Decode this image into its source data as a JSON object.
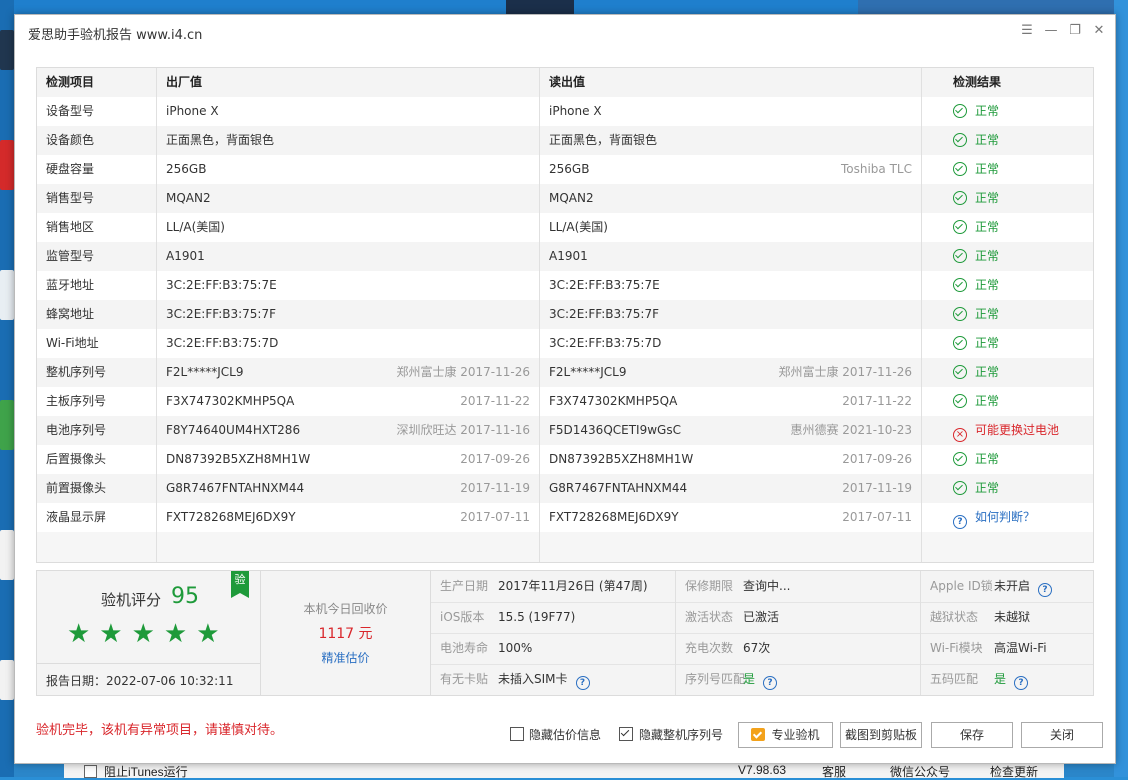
{
  "window": {
    "title": "爱思助手验机报告 www.i4.cn"
  },
  "table": {
    "headers": [
      "检测项目",
      "出厂值",
      "读出值",
      "检测结果"
    ],
    "rows": [
      {
        "item": "设备型号",
        "factory": "iPhone X",
        "factory_note": "",
        "read": "iPhone X",
        "read_note": "",
        "result": "正常",
        "status": "ok"
      },
      {
        "item": "设备颜色",
        "factory": "正面黑色，背面银色",
        "factory_note": "",
        "read": "正面黑色，背面银色",
        "read_note": "",
        "result": "正常",
        "status": "ok"
      },
      {
        "item": "硬盘容量",
        "factory": "256GB",
        "factory_note": "",
        "read": "256GB",
        "read_note": "Toshiba TLC",
        "result": "正常",
        "status": "ok"
      },
      {
        "item": "销售型号",
        "factory": "MQAN2",
        "factory_note": "",
        "read": "MQAN2",
        "read_note": "",
        "result": "正常",
        "status": "ok"
      },
      {
        "item": "销售地区",
        "factory": "LL/A(美国)",
        "factory_note": "",
        "read": "LL/A(美国)",
        "read_note": "",
        "result": "正常",
        "status": "ok"
      },
      {
        "item": "监管型号",
        "factory": "A1901",
        "factory_note": "",
        "read": "A1901",
        "read_note": "",
        "result": "正常",
        "status": "ok"
      },
      {
        "item": "蓝牙地址",
        "factory": "3C:2E:FF:B3:75:7E",
        "factory_note": "",
        "read": "3C:2E:FF:B3:75:7E",
        "read_note": "",
        "result": "正常",
        "status": "ok"
      },
      {
        "item": "蜂窝地址",
        "factory": "3C:2E:FF:B3:75:7F",
        "factory_note": "",
        "read": "3C:2E:FF:B3:75:7F",
        "read_note": "",
        "result": "正常",
        "status": "ok"
      },
      {
        "item": "Wi-Fi地址",
        "factory": "3C:2E:FF:B3:75:7D",
        "factory_note": "",
        "read": "3C:2E:FF:B3:75:7D",
        "read_note": "",
        "result": "正常",
        "status": "ok"
      },
      {
        "item": "整机序列号",
        "factory": "F2L*****JCL9",
        "factory_note": "郑州富士康 2017-11-26",
        "read": "F2L*****JCL9",
        "read_note": "郑州富士康 2017-11-26",
        "result": "正常",
        "status": "ok"
      },
      {
        "item": "主板序列号",
        "factory": "F3X747302KMHP5QA",
        "factory_note": "2017-11-22",
        "read": "F3X747302KMHP5QA",
        "read_note": "2017-11-22",
        "result": "正常",
        "status": "ok"
      },
      {
        "item": "电池序列号",
        "factory": "F8Y74640UM4HXT286",
        "factory_note": "深圳欣旺达 2017-11-16",
        "read": "F5D1436QCETI9wGsC",
        "read_note": "惠州德赛 2021-10-23",
        "result": "可能更换过电池",
        "status": "err"
      },
      {
        "item": "后置摄像头",
        "factory": "DN87392B5XZH8MH1W",
        "factory_note": "2017-09-26",
        "read": "DN87392B5XZH8MH1W",
        "read_note": "2017-09-26",
        "result": "正常",
        "status": "ok"
      },
      {
        "item": "前置摄像头",
        "factory": "G8R7467FNTAHNXM44",
        "factory_note": "2017-11-19",
        "read": "G8R7467FNTAHNXM44",
        "read_note": "2017-11-19",
        "result": "正常",
        "status": "ok"
      },
      {
        "item": "液晶显示屏",
        "factory": "FXT728268MEJ6DX9Y",
        "factory_note": "2017-07-11",
        "read": "FXT728268MEJ6DX9Y",
        "read_note": "2017-07-11",
        "result": "如何判断？",
        "status": "q"
      }
    ]
  },
  "score": {
    "label": "验机评分",
    "value": "95",
    "badge": "验",
    "stars": 5,
    "stars_text": "★★★★★",
    "report_date": "报告日期：2022-07-06 10:32:11"
  },
  "recycle": {
    "label": "本机今日回收价",
    "price": "1117",
    "unit": "元",
    "link": "精准估价"
  },
  "info": {
    "rows": [
      [
        {
          "k": "生产日期",
          "v": "2017年11月26日 (第47周)"
        },
        {
          "k": "保修期限",
          "v": "查询中..."
        },
        {
          "k": "Apple ID锁",
          "v": "未开启",
          "help": true
        }
      ],
      [
        {
          "k": "iOS版本",
          "v": "15.5 (19F77)"
        },
        {
          "k": "激活状态",
          "v": "已激活"
        },
        {
          "k": "越狱状态",
          "v": "未越狱"
        }
      ],
      [
        {
          "k": "电池寿命",
          "v": "100%"
        },
        {
          "k": "充电次数",
          "v": "67次"
        },
        {
          "k": "Wi-Fi模块",
          "v": "高温Wi-Fi"
        }
      ],
      [
        {
          "k": "有无卡贴",
          "v": "未插入SIM卡",
          "help": true
        },
        {
          "k": "序列号匹配",
          "v": "是",
          "green": true,
          "help": true
        },
        {
          "k": "五码匹配",
          "v": "是",
          "green": true,
          "help": true
        }
      ]
    ]
  },
  "footer": {
    "warning": "验机完毕，该机有异常项目，请谨慎对待。",
    "hide_price_label": "隐藏估价信息",
    "hide_price_checked": false,
    "hide_serial_label": "隐藏整机序列号",
    "hide_serial_checked": true,
    "pro_button": "专业验机",
    "screenshot_button": "截图到剪贴板",
    "save_button": "保存",
    "close_button": "关闭"
  },
  "behind_window": {
    "itunes_label": "阻止iTunes运行",
    "version": "V7.98.63",
    "service": "客服",
    "wechat": "微信公众号",
    "check_update": "检查更新"
  },
  "colors": {
    "ok": "#1e9a3a",
    "error": "#d9262b",
    "link": "#2a6fc2"
  }
}
